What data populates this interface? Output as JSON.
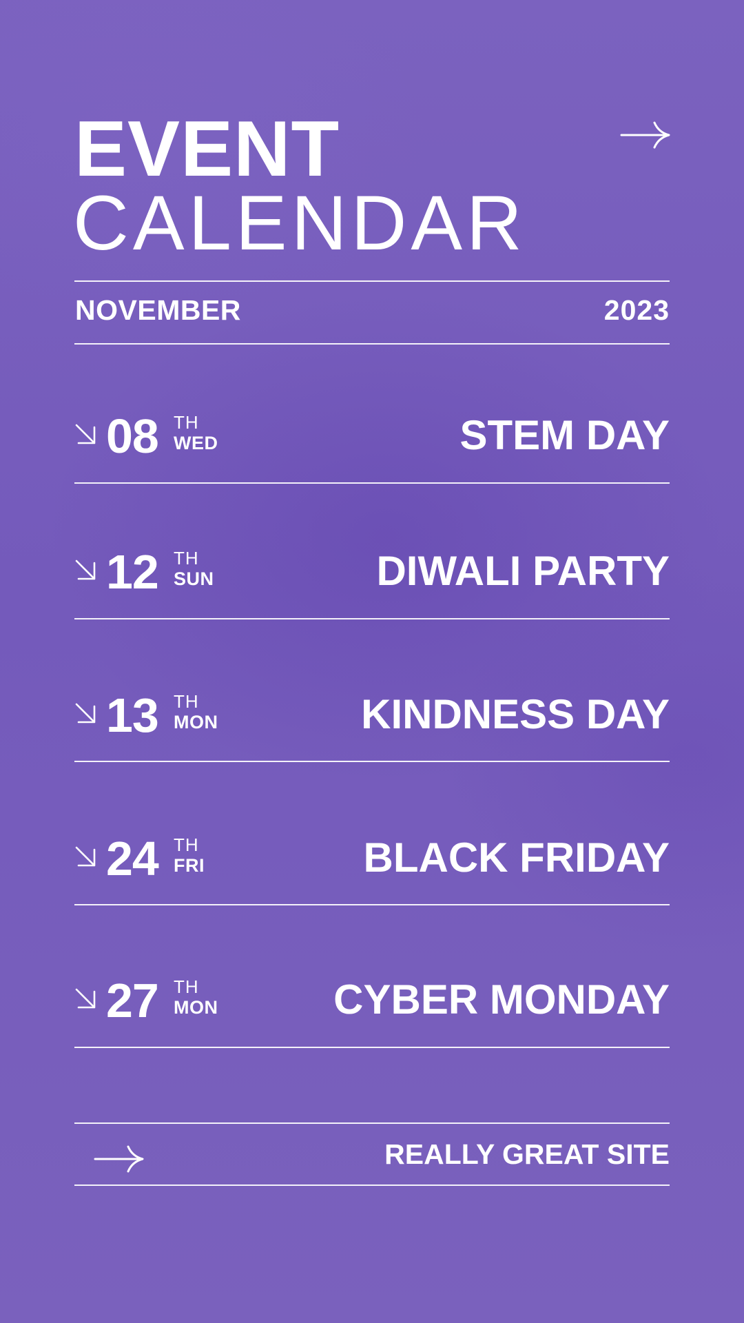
{
  "header": {
    "title_line1": "EVENT",
    "title_line2": "CALENDAR",
    "arrow_icon": "right-arrow-icon"
  },
  "period": {
    "month": "NOVEMBER",
    "year": "2023"
  },
  "events": [
    {
      "day": "08",
      "suffix": "TH",
      "weekday": "WED",
      "name": "STEM DAY",
      "icon": "down-right-arrow-icon"
    },
    {
      "day": "12",
      "suffix": "TH",
      "weekday": "SUN",
      "name": "DIWALI PARTY",
      "icon": "down-right-arrow-icon"
    },
    {
      "day": "13",
      "suffix": "TH",
      "weekday": "MON",
      "name": "KINDNESS DAY",
      "icon": "down-right-arrow-icon"
    },
    {
      "day": "24",
      "suffix": "TH",
      "weekday": "FRI",
      "name": "BLACK FRIDAY",
      "icon": "down-right-arrow-icon"
    },
    {
      "day": "27",
      "suffix": "TH",
      "weekday": "MON",
      "name": "CYBER MONDAY",
      "icon": "down-right-arrow-icon"
    }
  ],
  "footer": {
    "site": "REALLY GREAT SITE",
    "arrow_icon": "right-arrow-icon"
  },
  "colors": {
    "background": "#775dbb",
    "foreground": "#ffffff"
  }
}
